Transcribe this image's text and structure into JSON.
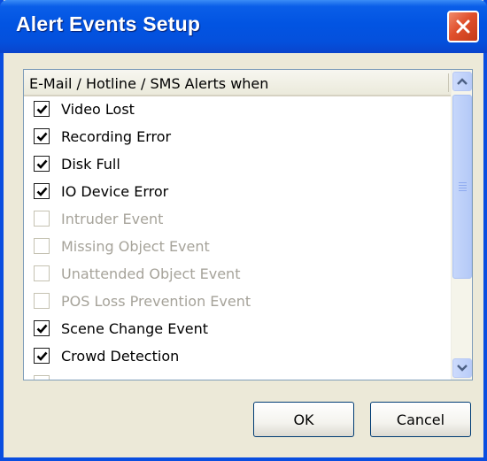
{
  "window": {
    "title": "Alert Events Setup"
  },
  "list": {
    "header": "E-Mail / Hotline / SMS Alerts when",
    "items": [
      {
        "label": "Video Lost",
        "checked": true,
        "enabled": true
      },
      {
        "label": "Recording Error",
        "checked": true,
        "enabled": true
      },
      {
        "label": "Disk Full",
        "checked": true,
        "enabled": true
      },
      {
        "label": "IO Device Error",
        "checked": true,
        "enabled": true
      },
      {
        "label": "Intruder Event",
        "checked": false,
        "enabled": false
      },
      {
        "label": "Missing Object Event",
        "checked": false,
        "enabled": false
      },
      {
        "label": "Unattended Object Event",
        "checked": false,
        "enabled": false
      },
      {
        "label": "POS Loss Prevention Event",
        "checked": false,
        "enabled": false
      },
      {
        "label": "Scene Change Event",
        "checked": true,
        "enabled": true
      },
      {
        "label": "Crowd Detection",
        "checked": true,
        "enabled": true
      }
    ]
  },
  "buttons": {
    "ok": "OK",
    "cancel": "Cancel"
  },
  "icons": {
    "close": "close-icon",
    "scroll_up": "chevron-up-icon",
    "scroll_down": "chevron-down-icon",
    "check": "check-icon"
  },
  "colors": {
    "titlebar": "#0254e2",
    "close_button": "#e0502c",
    "dialog_bg": "#ece9d8",
    "disabled_text": "#a6a39a"
  }
}
